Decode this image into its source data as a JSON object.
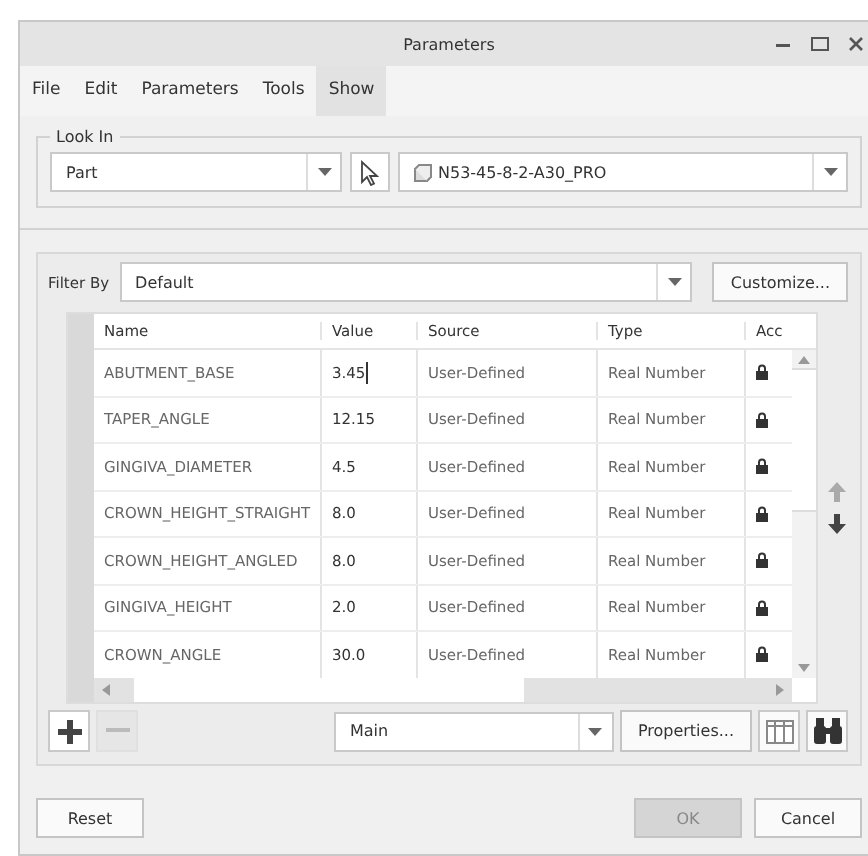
{
  "window": {
    "title": "Parameters"
  },
  "menu": [
    {
      "label": "File",
      "selected": false
    },
    {
      "label": "Edit",
      "selected": false
    },
    {
      "label": "Parameters",
      "selected": false
    },
    {
      "label": "Tools",
      "selected": false
    },
    {
      "label": "Show",
      "selected": true
    }
  ],
  "look_in": {
    "label": "Look In",
    "type_value": "Part",
    "model_value": "N53-45-8-2-A30_PRO"
  },
  "filter": {
    "label": "Filter By",
    "value": "Default",
    "button": "Customize..."
  },
  "table": {
    "columns": [
      "Name",
      "Value",
      "Source",
      "Type",
      "Acc"
    ],
    "rows": [
      {
        "name": "ABUTMENT_BASE",
        "value": "3.45",
        "source": "User-Defined",
        "type": "Real Number",
        "editing": true
      },
      {
        "name": "TAPER_ANGLE",
        "value": "12.15",
        "source": "User-Defined",
        "type": "Real Number",
        "editing": false
      },
      {
        "name": "GINGIVA_DIAMETER",
        "value": "4.5",
        "source": "User-Defined",
        "type": "Real Number",
        "editing": false
      },
      {
        "name": "CROWN_HEIGHT_STRAIGHT",
        "value": "8.0",
        "source": "User-Defined",
        "type": "Real Number",
        "editing": false
      },
      {
        "name": "CROWN_HEIGHT_ANGLED",
        "value": "8.0",
        "source": "User-Defined",
        "type": "Real Number",
        "editing": false
      },
      {
        "name": "GINGIVA_HEIGHT",
        "value": "2.0",
        "source": "User-Defined",
        "type": "Real Number",
        "editing": false
      },
      {
        "name": "CROWN_ANGLE",
        "value": "30.0",
        "source": "User-Defined",
        "type": "Real Number",
        "editing": false
      }
    ]
  },
  "toolbar": {
    "remove_disabled": true,
    "collection": "Main",
    "properties": "Properties..."
  },
  "buttons": [
    {
      "label": "Reset",
      "disabled": false
    },
    {
      "label": "OK",
      "disabled": true
    },
    {
      "label": "Cancel",
      "disabled": false
    }
  ]
}
